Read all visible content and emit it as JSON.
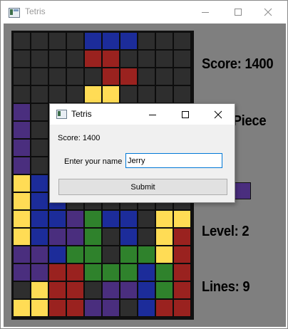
{
  "window": {
    "title": "Tetris"
  },
  "board": {
    "colors": {
      "E": "#2e2e2e",
      "B": "#1c2c9a",
      "R": "#9a221f",
      "Y": "#ffdc55",
      "P": "#4a2e7e",
      "G": "#2f822c"
    },
    "rows": [
      "EEEEBBBEEE",
      "EEEERREEEE",
      "EEEEERREEE",
      "EEEEYYEEEE",
      "PEEEEEEEEE",
      "PEEEEEEEEE",
      "PEEEEEEEEE",
      "PEEEEEEEEE",
      "YBEEEEEEEE",
      "YBBEEEEEEE",
      "YBBPGBBEYY",
      "YBPPGEBEYR",
      "PPBGGEGGYR",
      "PPRRGGGBGR",
      "EYRREPPBGR",
      "YYRRPPEBRR"
    ]
  },
  "side": {
    "score": "Score: 1400",
    "next_piece": "Next Piece",
    "level": "Level: 2",
    "lines": "Lines: 9"
  },
  "dialog": {
    "title": "Tetris",
    "score_text": "Score: 1400",
    "name_label": "Enter your name",
    "name_value": "Jerry",
    "submit_label": "Submit"
  }
}
